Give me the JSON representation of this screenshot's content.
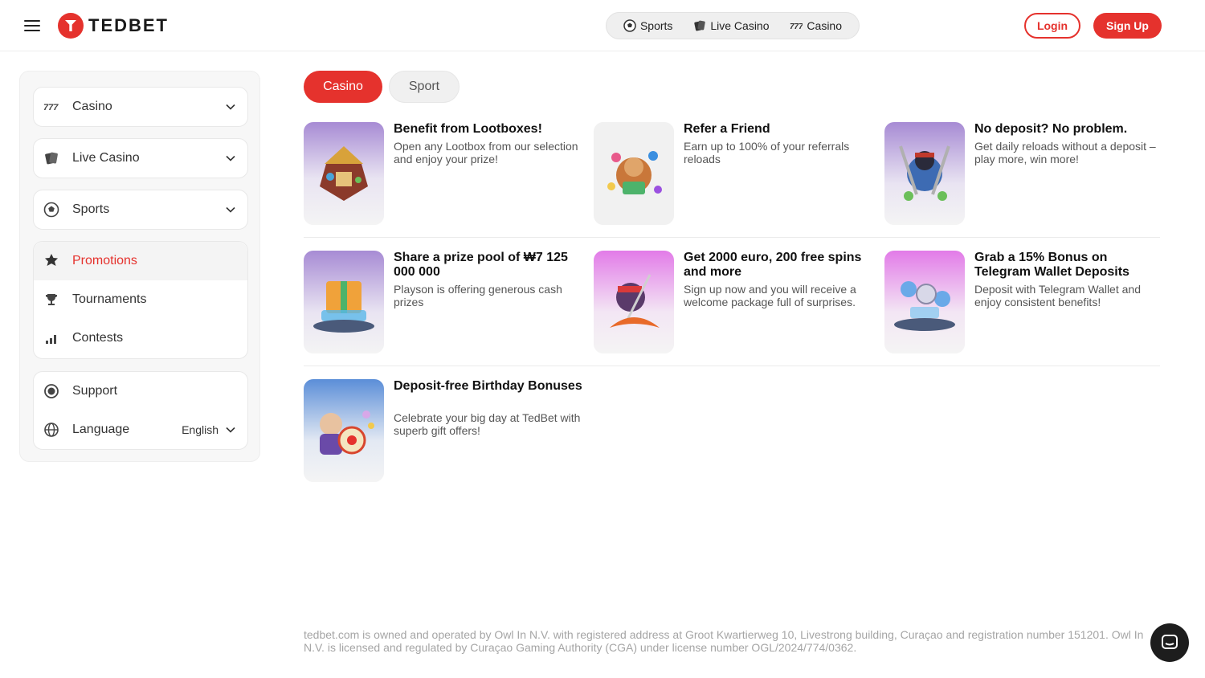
{
  "header": {
    "logo_text": "TEDBET",
    "nav": [
      {
        "label": "Sports",
        "icon": "soccer-ball-icon"
      },
      {
        "label": "Live Casino",
        "icon": "playing-cards-icon"
      },
      {
        "label": "Casino",
        "icon": "slot-777-icon"
      }
    ],
    "login_label": "Login",
    "signup_label": "Sign Up"
  },
  "sidebar": {
    "casino": "Casino",
    "live_casino": "Live Casino",
    "sports": "Sports",
    "promotions": "Promotions",
    "tournaments": "Tournaments",
    "contests": "Contests",
    "support": "Support",
    "language_label": "Language",
    "language_value": "English"
  },
  "tabs": {
    "casino": "Casino",
    "sport": "Sport"
  },
  "promotions": [
    {
      "title": "Benefit from Lootboxes!",
      "description": "Open any Lootbox from our selection and enjoy your prize!"
    },
    {
      "title": "Refer a Friend",
      "description": "Earn up to 100% of your referrals reloads"
    },
    {
      "title": "No deposit? No problem.",
      "description": "Get daily reloads without a deposit – play more, win more!"
    },
    {
      "title": "Share a prize pool of ₩7 125 000 000",
      "description": "Playson is offering generous cash prizes"
    },
    {
      "title": "Get 2000 euro, 200 free spins and more",
      "description": "Sign up now and you will receive a welcome package full of surprises."
    },
    {
      "title": "Grab a 15% Bonus on Telegram Wallet Deposits",
      "description": "Deposit with Telegram Wallet and enjoy consistent benefits!"
    },
    {
      "title": "Deposit-free Birthday Bonuses",
      "description": "Celebrate your big day at TedBet with superb gift offers!"
    }
  ],
  "footer": {
    "legal": "tedbet.com is owned and operated by Owl In N.V. with registered address at Groot Kwartierweg 10, Livestrong building, Curaçao and registration number 151201. Owl In N.V. is licensed and regulated by Curaçao Gaming Authority (CGA) under license number OGL/2024/774/0362."
  },
  "colors": {
    "accent": "#e5322d",
    "text": "#1a1a1a",
    "muted": "#a5a5a5"
  }
}
